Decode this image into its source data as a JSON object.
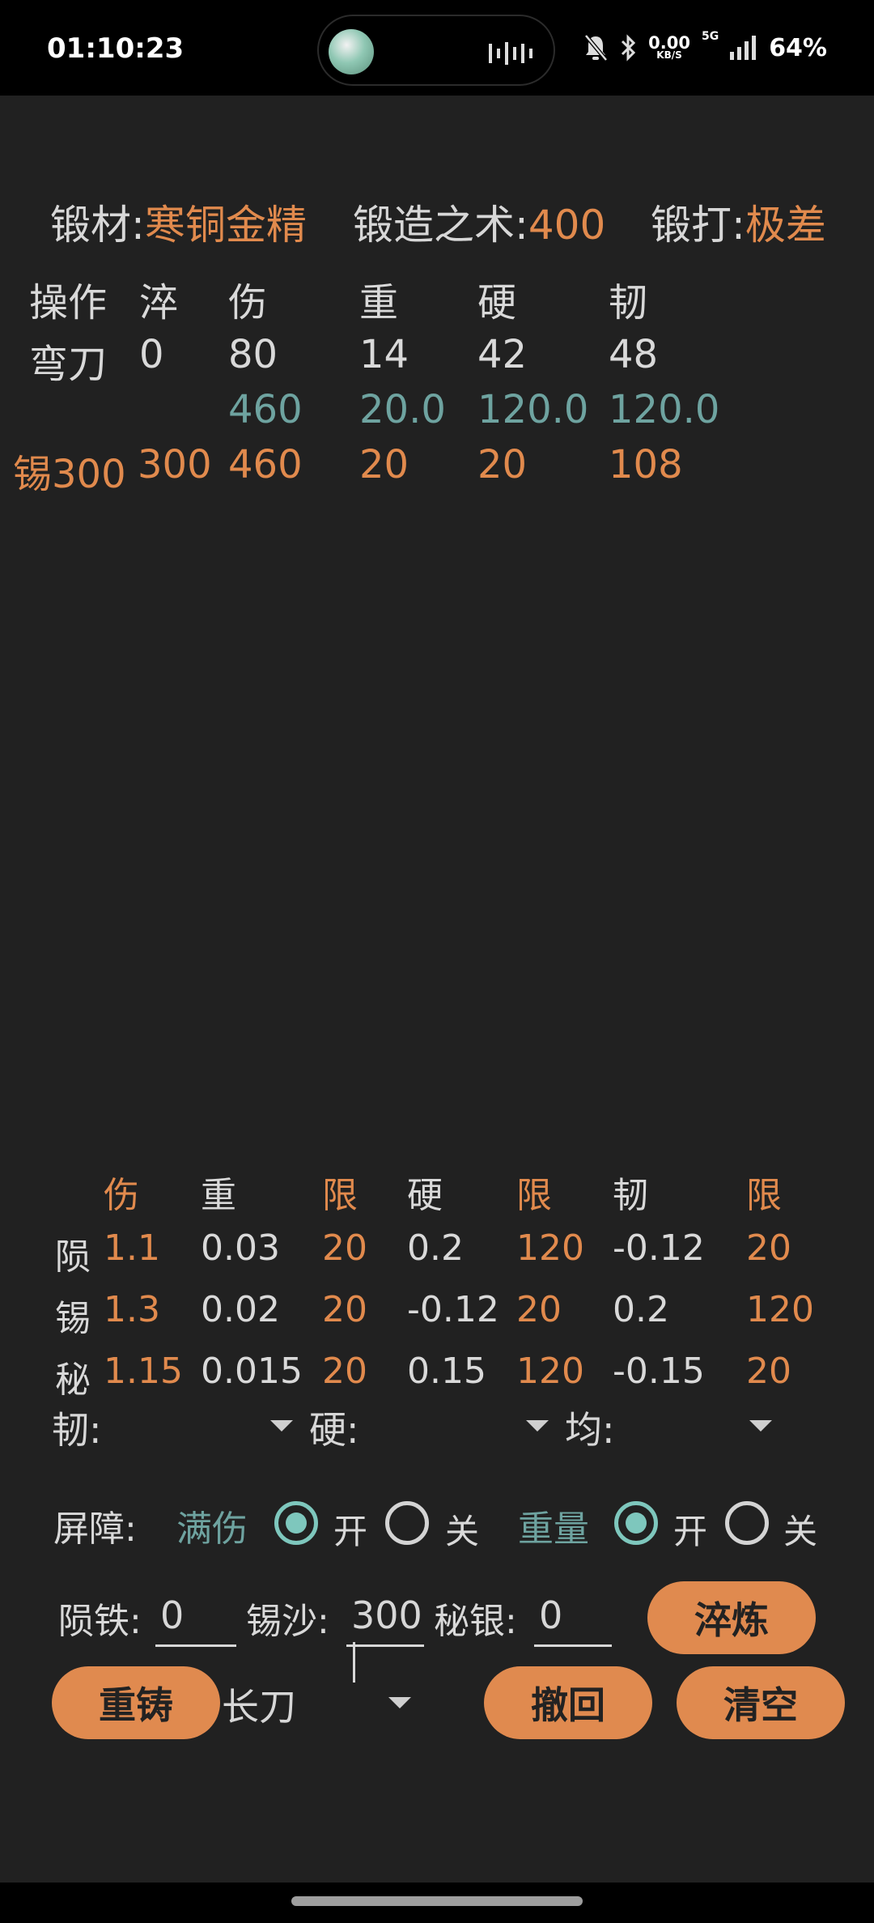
{
  "status": {
    "time": "01:10:23",
    "net_speed": "0.00",
    "net_unit": "KB/S",
    "net_type": "5G",
    "battery": "64%"
  },
  "header": {
    "material_label": "锻材:",
    "material_value": "寒铜金精",
    "skill_label": "锻造之术:",
    "skill_value": "400",
    "quality_label": "锻打:",
    "quality_value": "极差"
  },
  "stats_table": {
    "headers": [
      "操作",
      "淬",
      "伤",
      "重",
      "硬",
      "韧"
    ],
    "row1": [
      "弯刀",
      "0",
      "80",
      "14",
      "42",
      "48"
    ],
    "row2": [
      "460",
      "20.0",
      "120.0",
      "120.0"
    ],
    "row3": [
      "锡300",
      "300",
      "460",
      "20",
      "20",
      "108"
    ]
  },
  "coef_table": {
    "headers": [
      "伤",
      "重",
      "限",
      "硬",
      "限",
      "韧",
      "限"
    ],
    "rows": [
      {
        "name": "陨",
        "values": [
          "1.1",
          "0.03",
          "20",
          "0.2",
          "120",
          "-0.12",
          "20"
        ]
      },
      {
        "name": "锡",
        "values": [
          "1.3",
          "0.02",
          "20",
          "-0.12",
          "20",
          "0.2",
          "120"
        ]
      },
      {
        "name": "秘",
        "values": [
          "1.15",
          "0.015",
          "20",
          "0.15",
          "120",
          "-0.15",
          "20"
        ]
      }
    ]
  },
  "filters": {
    "tough_label": "韧:",
    "hard_label": "硬:",
    "avg_label": "均:"
  },
  "barrier": {
    "label": "屏障:",
    "full_damage": "满伤",
    "on": "开",
    "off": "关",
    "weight": "重量",
    "on2": "开",
    "off2": "关"
  },
  "inputs": {
    "meteor_label": "陨铁:",
    "meteor_value": "0",
    "tin_label": "锡沙:",
    "tin_value": "300",
    "silver_label": "秘银:",
    "silver_value": "0"
  },
  "buttons": {
    "quench": "淬炼",
    "recast": "重铸",
    "weapon_select": "长刀",
    "undo": "撤回",
    "clear": "清空"
  },
  "colors": {
    "accent_orange": "#e08a4f",
    "accent_teal": "#7ec7bd",
    "background": "#212121"
  }
}
